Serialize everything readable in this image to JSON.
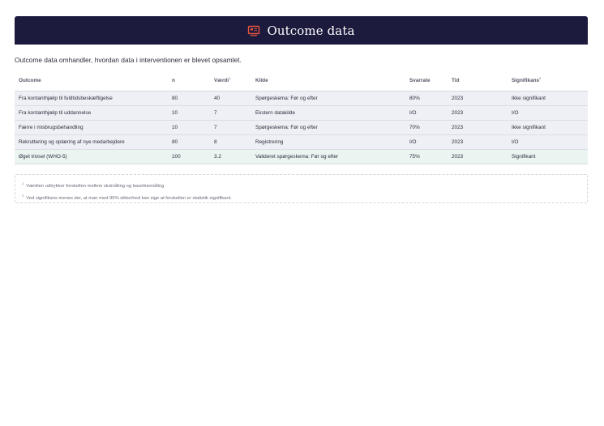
{
  "header": {
    "title": "Outcome data",
    "icon": "presentation-icon",
    "accent": "#e8553f"
  },
  "intro": "Outcome data omhandler, hvordan data i interventionen er blevet opsamlet.",
  "table": {
    "columns": {
      "outcome": "Outcome",
      "n": "n",
      "vaerdi": "Værdi",
      "vaerdi_mark": "1",
      "kilde": "Kilde",
      "svarrate": "Svarrate",
      "tid": "Tid",
      "signifikans": "Signifikans",
      "signifikans_mark": "2"
    },
    "rows": [
      {
        "outcome": "Fra kontanthjælp til fuldtidsbeskæftigelse",
        "n": "80",
        "vaerdi": "40",
        "kilde": "Spørgeskema: Før og efter",
        "svarrate": "80%",
        "tid": "2023",
        "signifikans": "Ikke signifikant"
      },
      {
        "outcome": "Fra kontanthjælp til uddannelse",
        "n": "10",
        "vaerdi": "7",
        "kilde": "Ekstern datakilde",
        "svarrate": "I/O",
        "tid": "2023",
        "signifikans": "I/O"
      },
      {
        "outcome": "Færre i misbrugsbehandling",
        "n": "10",
        "vaerdi": "7",
        "kilde": "Spørgeskema: Før og efter",
        "svarrate": "70%",
        "tid": "2023",
        "signifikans": "Ikke signifikant"
      },
      {
        "outcome": "Rekruttering og oplæring af nye medarbejdere",
        "n": "80",
        "vaerdi": "8",
        "kilde": "Registrering",
        "svarrate": "I/O",
        "tid": "2023",
        "signifikans": "I/O"
      },
      {
        "outcome": "Øget trivsel (WHO-5)",
        "n": "100",
        "vaerdi": "3.2",
        "kilde": "Valideret spørgeskema: Før og efter",
        "svarrate": "75%",
        "tid": "2023",
        "signifikans": "Signifikant"
      }
    ]
  },
  "footnotes": [
    {
      "mark": "1",
      "text": "Værdien udtrykker forskellen mellem slutmåling og baselinemåling"
    },
    {
      "mark": "2",
      "text": "Ved signifikans menes der, at man med 95% sikkerhed kan sige at forskellen er statistik signifikant."
    }
  ]
}
